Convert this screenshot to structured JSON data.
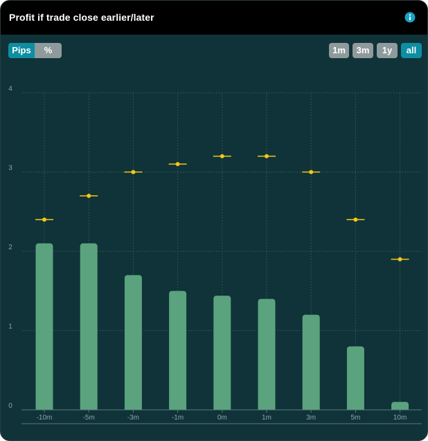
{
  "header": {
    "title": "Profit if trade close earlier/later",
    "info_icon": "info-icon"
  },
  "unit_toggle": [
    {
      "label": "Pips",
      "active": true
    },
    {
      "label": "%",
      "active": false
    }
  ],
  "range_buttons": [
    {
      "label": "1m",
      "active": false
    },
    {
      "label": "3m",
      "active": false
    },
    {
      "label": "1y",
      "active": false
    },
    {
      "label": "all",
      "active": true
    }
  ],
  "colors": {
    "bar": "#5ba37e",
    "marker": "#f5c518",
    "active_button": "#0d8ea3",
    "inactive_button": "#8f9a9c",
    "background": "#0f3338"
  },
  "chart_data": {
    "type": "bar",
    "categories": [
      "-10m",
      "-5m",
      "-3m",
      "-1m",
      "0m",
      "1m",
      "3m",
      "5m",
      "10m"
    ],
    "series": [
      {
        "values": [
          2.1,
          2.1,
          1.7,
          1.5,
          1.44,
          1.4,
          1.2,
          0.8,
          0.1
        ]
      },
      {
        "type": "marker",
        "values": [
          2.4,
          2.7,
          3.0,
          3.1,
          3.2,
          3.2,
          3.0,
          2.4,
          1.9
        ]
      }
    ],
    "yticks": [
      0,
      1,
      2,
      3,
      4
    ],
    "ylim": [
      0,
      4
    ],
    "grid": true
  }
}
